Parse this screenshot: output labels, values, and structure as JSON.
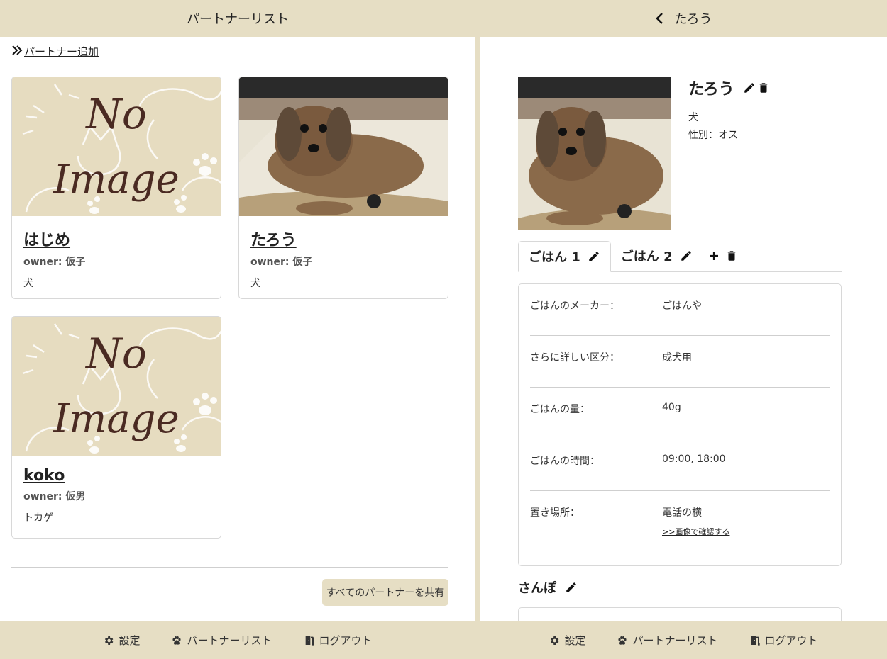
{
  "left": {
    "header_title": "パートナーリスト",
    "add_partner_label": "パートナー追加",
    "cards": [
      {
        "name": "はじめ",
        "owner_label": "owner:",
        "owner": "仮子",
        "species": "犬",
        "image": "no-image",
        "no_image_line1": "No",
        "no_image_line2": "Image"
      },
      {
        "name": "たろう",
        "owner_label": "owner:",
        "owner": "仮子",
        "species": "犬",
        "image": "dog-photo"
      },
      {
        "name": "koko",
        "owner_label": "owner:",
        "owner": "仮男",
        "species": "トカゲ",
        "image": "no-image",
        "no_image_line1": "No",
        "no_image_line2": "Image"
      }
    ],
    "share_button": "すべてのパートナーを共有"
  },
  "right": {
    "header_title": "たろう",
    "pet": {
      "name": "たろう",
      "species": "犬",
      "sex_label": "性別：",
      "sex": "オス"
    },
    "tabs": [
      {
        "label": "ごはん 1"
      },
      {
        "label": "ごはん 2"
      }
    ],
    "food_rows": [
      {
        "label": "ごはんのメーカー：",
        "value": "ごはんや"
      },
      {
        "label": "さらに詳しい区分：",
        "value": "成犬用"
      },
      {
        "label": "ごはんの量：",
        "value": "40g"
      },
      {
        "label": "ごはんの時間：",
        "value": "09:00, 18:00"
      },
      {
        "label": "置き場所：",
        "value": "電話の横",
        "link": ">>画像で確認する"
      }
    ],
    "walk_title": "さんぽ"
  },
  "footer": {
    "settings": "設定",
    "partner_list": "パートナーリスト",
    "logout": "ログアウト"
  },
  "colors": {
    "header_bg": "#e6dec4",
    "no_image_bg": "#e6dcc0",
    "no_image_text": "#4a2a22"
  },
  "icons": [
    "chevron-left-icon",
    "double-chevron-right-icon",
    "pencil-icon",
    "trash-icon",
    "plus-icon",
    "gear-icon",
    "paw-icon",
    "door-icon"
  ]
}
